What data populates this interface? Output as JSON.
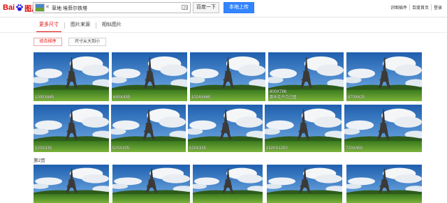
{
  "header": {
    "logo_part1": "Bai",
    "logo_part2": "图片",
    "search_query": "草地 埃菲尔铁塔",
    "search_button": "百度一下",
    "upload_button": "本地上传",
    "links": [
      "识图插件",
      "百度首页",
      "登录"
    ]
  },
  "tabs": [
    {
      "label": "更多尺寸",
      "active": true
    },
    {
      "label": "图片来源",
      "active": false
    },
    {
      "label": "相似图片",
      "active": false
    }
  ],
  "sort": {
    "option1": "综合排序",
    "option2": "尺寸从大到小"
  },
  "images_row1": [
    {
      "size": "1000X645"
    },
    {
      "size": "680X439"
    },
    {
      "size": "1024X660"
    },
    {
      "size": "800X786",
      "caption": "那年花开月正圆"
    },
    {
      "size": "970X625"
    }
  ],
  "images_row2": [
    {
      "size": "520X335"
    },
    {
      "size": "520X335"
    },
    {
      "size": "520X335"
    },
    {
      "size": "1920X1200"
    },
    {
      "size": "720X450"
    }
  ],
  "page_label": "第2页",
  "colors": {
    "brand_red": "#e10601",
    "primary_blue": "#3385ff"
  },
  "icons": [
    "baidu-paw-icon",
    "camera-icon",
    "close-icon"
  ]
}
